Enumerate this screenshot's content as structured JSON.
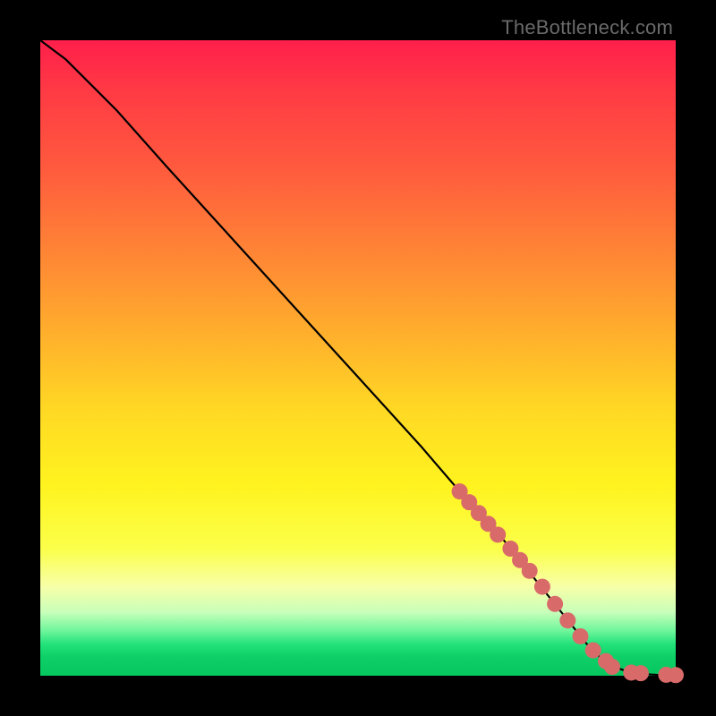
{
  "watermark": "TheBottleneck.com",
  "colors": {
    "dot": "#d96a6a",
    "line": "#000000"
  },
  "chart_data": {
    "type": "line",
    "title": "",
    "xlabel": "",
    "ylabel": "",
    "xlim": [
      0,
      100
    ],
    "ylim": [
      0,
      100
    ],
    "grid": false,
    "legend": false,
    "series": [
      {
        "name": "curve",
        "style": "line",
        "x": [
          0,
          4,
          8,
          12,
          20,
          30,
          40,
          50,
          60,
          66,
          70,
          74,
          78,
          82,
          86,
          88,
          90,
          92,
          94,
          96,
          98,
          100
        ],
        "y": [
          100,
          97,
          93,
          89,
          80,
          69,
          58,
          47,
          36,
          29,
          25,
          20,
          15,
          10,
          5,
          3,
          1.5,
          0.8,
          0.4,
          0.2,
          0.1,
          0.1
        ]
      },
      {
        "name": "highlight-dots",
        "style": "scatter",
        "x": [
          66,
          67.5,
          69,
          70.5,
          72,
          74,
          75.5,
          77,
          79,
          81,
          83,
          85,
          87,
          89,
          90,
          93,
          94.5,
          98.5,
          100
        ],
        "y": [
          29,
          27.3,
          25.6,
          23.9,
          22.2,
          20,
          18.2,
          16.5,
          14,
          11.3,
          8.7,
          6.2,
          4,
          2.3,
          1.4,
          0.5,
          0.4,
          0.15,
          0.1
        ]
      }
    ]
  }
}
